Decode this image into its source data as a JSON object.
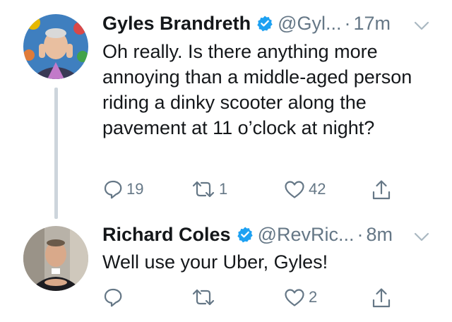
{
  "tweets": [
    {
      "name": "Gyles Brandreth",
      "handle": "@Gyl...",
      "separator": "·",
      "time": "17m",
      "text": "Oh really. Is there anything more annoying than a middle-aged person riding a dinky scooter along the pavement at 11 o’clock at night?",
      "replies": "19",
      "retweets": "1",
      "likes": "42"
    },
    {
      "name": "Richard Coles",
      "handle": "@RevRic...",
      "separator": "·",
      "time": "8m",
      "text": "Well use your Uber, Gyles!",
      "replies": "",
      "retweets": "",
      "likes": "2"
    }
  ],
  "colors": {
    "accent": "#1da1f2",
    "text": "#14171a",
    "secondary": "#657786",
    "thread_line": "#cdd5dc"
  },
  "icons": [
    "verified-badge-icon",
    "chevron-down-icon",
    "reply-icon",
    "retweet-icon",
    "like-icon",
    "share-icon"
  ]
}
